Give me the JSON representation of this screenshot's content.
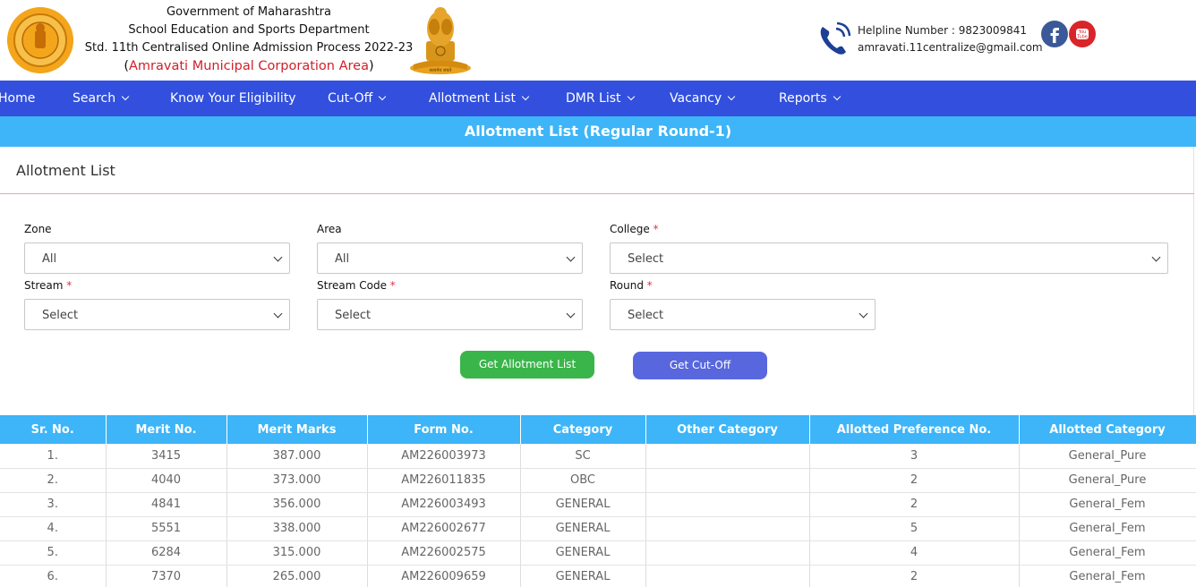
{
  "header": {
    "line1": "Government of Maharashtra",
    "line2": "School Education and Sports Department",
    "line3": "Std. 11th Centralised Online Admission Process 2022-23",
    "paren_open": "(",
    "area": "Amravati Municipal Corporation Area",
    "paren_close": ")",
    "helpline": "Helpline Number : 9823009841",
    "email": "amravati.11centralize@gmail.com",
    "emblem_text": "सत्यमेव जयते"
  },
  "nav": {
    "items": [
      {
        "label": "Home"
      },
      {
        "label": "Search"
      },
      {
        "label": "Know Your Eligibility"
      },
      {
        "label": "Cut-Off"
      },
      {
        "label": "Allotment List"
      },
      {
        "label": "DMR List"
      },
      {
        "label": "Vacancy"
      },
      {
        "label": "Reports"
      }
    ]
  },
  "banner": "Allotment List (Regular Round-1)",
  "card": {
    "title": "Allotment List"
  },
  "form": {
    "zone": {
      "label": "Zone",
      "value": "All"
    },
    "area": {
      "label": "Area",
      "value": "All"
    },
    "college": {
      "label": "College",
      "value": "Select"
    },
    "stream": {
      "label": "Stream",
      "value": "Select"
    },
    "stream_code": {
      "label": "Stream Code",
      "value": "Select"
    },
    "round": {
      "label": "Round",
      "value": "Select"
    },
    "required_mark": "*"
  },
  "buttons": {
    "get_allotment": "Get Allotment List",
    "get_cutoff": "Get Cut-Off"
  },
  "table": {
    "headers": [
      "Sr. No.",
      "Merit No.",
      "Merit Marks",
      "Form No.",
      "Category",
      "Other Category",
      "Allotted Preference No.",
      "Allotted Category"
    ],
    "rows": [
      [
        "1.",
        "3415",
        "387.000",
        "AM226003973",
        "SC",
        "",
        "3",
        "General_Pure"
      ],
      [
        "2.",
        "4040",
        "373.000",
        "AM226011835",
        "OBC",
        "",
        "2",
        "General_Pure"
      ],
      [
        "3.",
        "4841",
        "356.000",
        "AM226003493",
        "GENERAL",
        "",
        "2",
        "General_Fem"
      ],
      [
        "4.",
        "5551",
        "338.000",
        "AM226002677",
        "GENERAL",
        "",
        "5",
        "General_Fem"
      ],
      [
        "5.",
        "6284",
        "315.000",
        "AM226002575",
        "GENERAL",
        "",
        "4",
        "General_Fem"
      ],
      [
        "6.",
        "7370",
        "265.000",
        "AM226009659",
        "GENERAL",
        "",
        "2",
        "General_Fem"
      ]
    ]
  },
  "colors": {
    "nav_bg": "#3250dd",
    "banner_bg": "#3db5f8",
    "green_button": "#3ab54a",
    "blue_button": "#5867dd",
    "required": "#e53040",
    "area_text": "#d0202a"
  },
  "icons": {
    "left_logo": "maharashtra-seal-icon",
    "emblem": "ashoka-emblem-icon",
    "phone": "phone-icon",
    "facebook": "facebook-icon",
    "youtube": "youtube-icon"
  }
}
